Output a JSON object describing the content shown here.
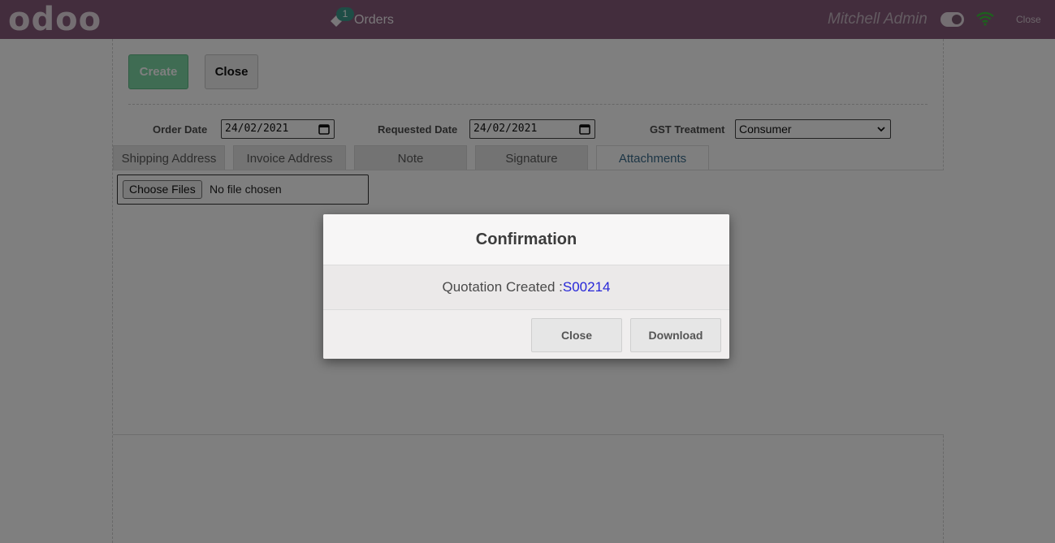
{
  "topbar": {
    "logo": "odoo",
    "orders_label": "Orders",
    "orders_badge": "1",
    "user_name": "Mitchell Admin",
    "close_label": "Close"
  },
  "actions": {
    "create_label": "Create",
    "close_label": "Close"
  },
  "form": {
    "order_date_label": "Order Date",
    "order_date_value": "24/02/2021",
    "requested_date_label": "Requested Date",
    "requested_date_value": "24/02/2021",
    "gst_label": "GST Treatment",
    "gst_value": "Consumer"
  },
  "tabs": [
    {
      "label": "Shipping Address"
    },
    {
      "label": "Invoice Address"
    },
    {
      "label": "Note"
    },
    {
      "label": "Signature"
    },
    {
      "label": "Attachments",
      "active": true
    }
  ],
  "attachments": {
    "choose_label": "Choose Files",
    "status": "No file chosen"
  },
  "dialog": {
    "title": "Confirmation",
    "message_prefix": "Quotation Created :",
    "quotation_ref": "S00214",
    "close_label": "Close",
    "download_label": "Download"
  },
  "colors": {
    "brand": "#875a7b",
    "create_button": "#7fd8a6",
    "badge": "#3d9b8d",
    "link": "#2727d8",
    "wifi": "#3cbf3c"
  },
  "icons": {
    "orders": "tag-icon",
    "connection": "wifi-icon",
    "date": "calendar-icon",
    "select": "chevron-down-icon"
  }
}
